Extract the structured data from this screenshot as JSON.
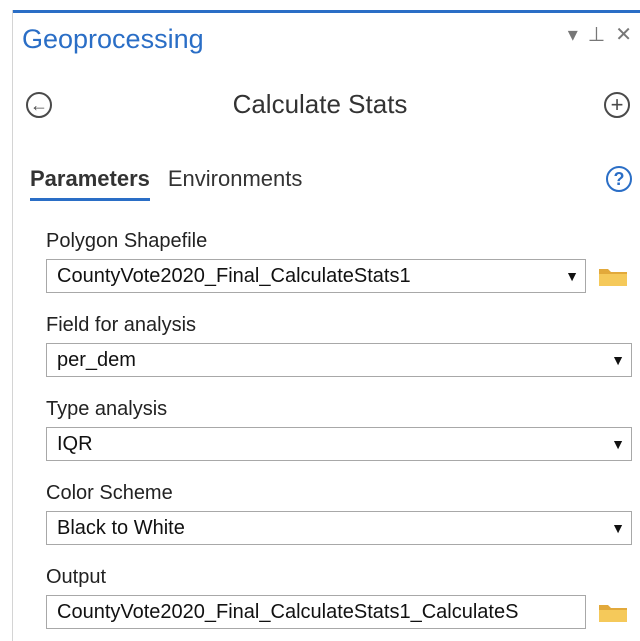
{
  "pane": {
    "title": "Geoprocessing",
    "controls": [
      "▾",
      "⊥",
      "✕"
    ]
  },
  "tool": {
    "title": "Calculate Stats"
  },
  "tabs": [
    {
      "label": "Parameters",
      "active": true
    },
    {
      "label": "Environments",
      "active": false
    }
  ],
  "help_symbol": "?",
  "params": [
    {
      "label": "Polygon Shapefile",
      "value": "CountyVote2020_Final_CalculateStats1"
    },
    {
      "label": "Field for analysis",
      "value": "per_dem"
    },
    {
      "label": "Type analysis",
      "value": "IQR"
    },
    {
      "label": "Color Scheme",
      "value": "Black to White"
    },
    {
      "label": "Output",
      "value": "CountyVote2020_Final_CalculateStats1_CalculateS"
    }
  ],
  "colors": {
    "accent": "#2a6ec6",
    "folder": "#f2c14e"
  }
}
